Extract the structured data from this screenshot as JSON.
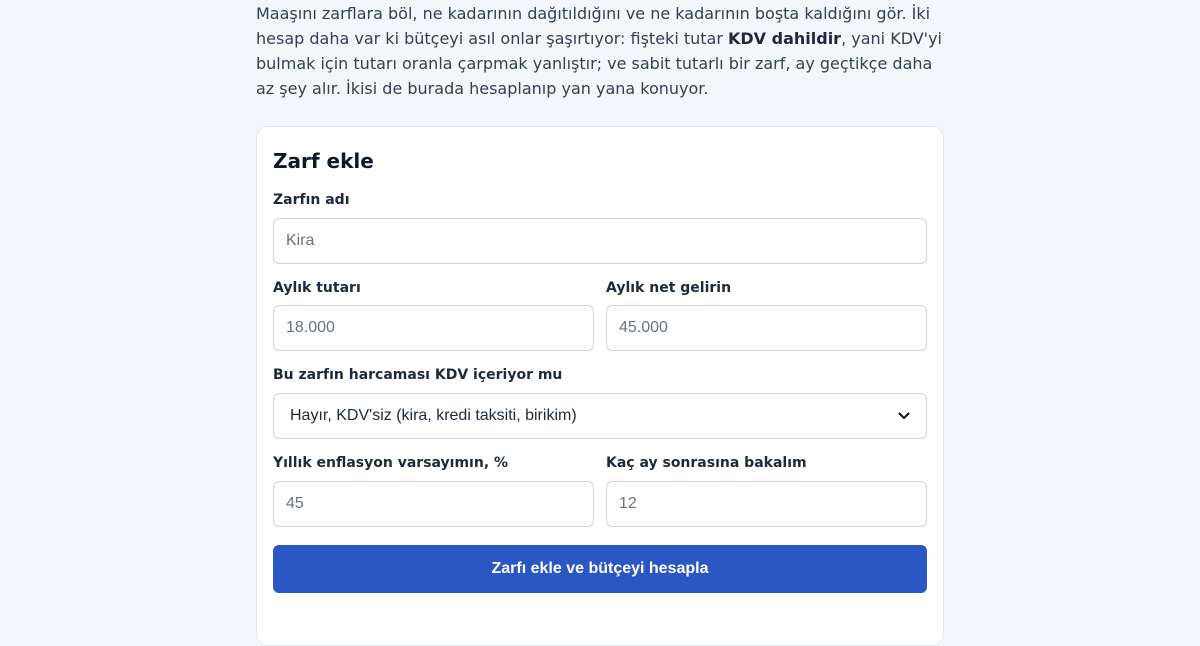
{
  "intro": {
    "text_before": "Maaşını zarflara böl, ne kadarının dağıtıldığını ve ne kadarının boşta kaldığını gör. İki hesap daha var ki bütçeyi asıl onlar şaşırtıyor: fişteki tutar ",
    "bold": "KDV dahildir",
    "text_after": ", yani KDV'yi bulmak için tutarı oranla çarpmak yanlıştır; ve sabit tutarlı bir zarf, ay geçtikçe daha az şey alır. İkisi de burada hesaplanıp yan yana konuyor."
  },
  "form": {
    "title": "Zarf ekle",
    "name": {
      "label": "Zarfın adı",
      "placeholder": "Kira"
    },
    "monthly_amount": {
      "label": "Aylık tutarı",
      "placeholder": "18.000"
    },
    "net_income": {
      "label": "Aylık net gelirin",
      "placeholder": "45.000"
    },
    "vat": {
      "label": "Bu zarfın harcaması KDV içeriyor mu",
      "selected": "Hayır, KDV'siz (kira, kredi taksiti, birikim)"
    },
    "inflation": {
      "label": "Yıllık enflasyon varsayımın, %",
      "placeholder": "45"
    },
    "months": {
      "label": "Kaç ay sonrasına bakalım",
      "placeholder": "12"
    },
    "submit_label": "Zarfı ekle ve bütçeyi hesapla"
  },
  "colors": {
    "accent": "#2b57c4",
    "background": "#f3f6fb"
  }
}
